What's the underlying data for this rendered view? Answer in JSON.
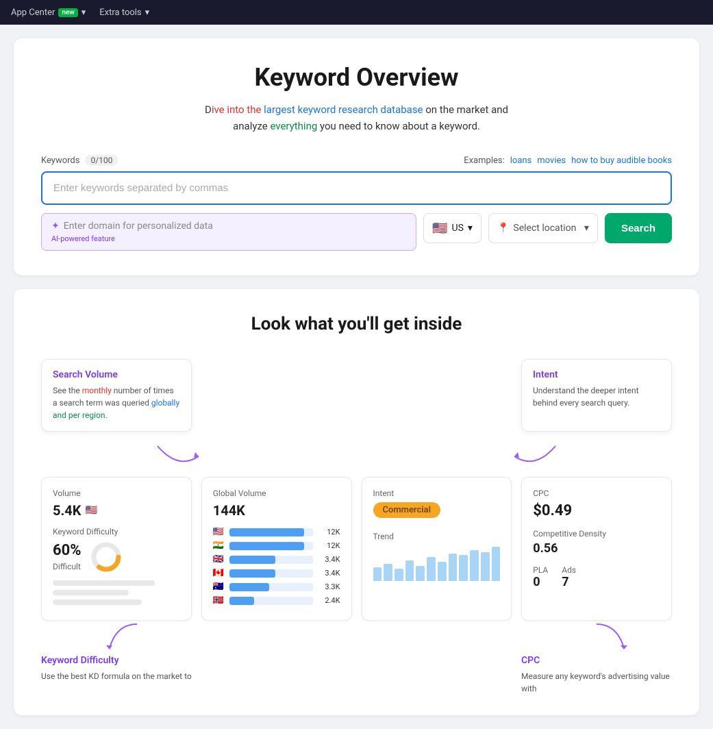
{
  "nav": {
    "app_center": "App Center",
    "app_center_badge": "new",
    "extra_tools": "Extra tools"
  },
  "hero": {
    "title": "Keyword Overview",
    "subtitle_line1": "Dive into the largest keyword research database on the market and",
    "subtitle_line2": "analyze everything you need to know about a keyword.",
    "keywords_label": "Keywords",
    "keywords_counter": "0/100",
    "keywords_placeholder": "Enter keywords separated by commas",
    "examples_label": "Examples:",
    "example1": "loans",
    "example2": "movies",
    "example3": "how to buy audible books",
    "domain_placeholder": "Enter domain for personalized data",
    "ai_label": "AI-powered feature",
    "country": "US",
    "location_placeholder": "Select location",
    "search_btn": "Search"
  },
  "preview": {
    "title": "Look what you'll get inside",
    "feature1_title": "Search Volume",
    "feature1_desc": "See the monthly number of times a search term was queried globally and per region.",
    "feature2_title": "Intent",
    "feature2_desc": "Understand the deeper intent behind every search query.",
    "volume_label": "Volume",
    "volume_value": "5.4K",
    "kd_label": "Keyword Difficulty",
    "kd_value": "60%",
    "kd_tag": "Difficult",
    "global_vol_label": "Global Volume",
    "global_vol_value": "144K",
    "global_rows": [
      {
        "flag": "🇺🇸",
        "bar": 90,
        "value": "12K"
      },
      {
        "flag": "🇮🇳",
        "bar": 90,
        "value": "12K"
      },
      {
        "flag": "🇬🇧",
        "bar": 55,
        "value": "3.4K"
      },
      {
        "flag": "🇨🇦",
        "bar": 55,
        "value": "3.4K"
      },
      {
        "flag": "🇦🇺",
        "bar": 48,
        "value": "3.3K"
      },
      {
        "flag": "🇳🇴",
        "bar": 30,
        "value": "2.4K"
      }
    ],
    "intent_label": "Intent",
    "intent_badge": "Commercial",
    "trend_label": "Trend",
    "trend_bars": [
      20,
      25,
      18,
      30,
      22,
      35,
      28,
      40,
      38,
      45,
      42,
      50
    ],
    "cpc_label": "CPC",
    "cpc_value": "$0.49",
    "cd_label": "Competitive Density",
    "cd_value": "0.56",
    "pla_label": "PLA",
    "pla_value": "0",
    "ads_label": "Ads",
    "ads_value": "7",
    "bottom_feature1_title": "Keyword Difficulty",
    "bottom_feature1_desc": "Use the best KD formula on the market to",
    "bottom_feature2_title": "CPC",
    "bottom_feature2_desc": "Measure any keyword's advertising value with"
  }
}
